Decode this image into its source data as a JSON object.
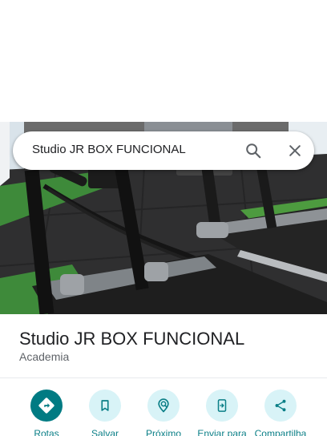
{
  "search": {
    "query": "Studio JR BOX FUNCIONAL",
    "search_icon": "search-icon",
    "clear_icon": "close-icon"
  },
  "place": {
    "photo": "gym-treadmills-photo",
    "name": "Studio JR BOX FUNCIONAL",
    "category": "Academia"
  },
  "actions": [
    {
      "label": "Rotas",
      "icon": "directions-icon"
    },
    {
      "label": "Salvar",
      "icon": "bookmark-icon"
    },
    {
      "label": "Próximo",
      "icon": "nearby-icon"
    },
    {
      "label": "Enviar para",
      "icon": "send-to-phone-icon"
    },
    {
      "label": "Compartilha",
      "icon": "share-icon"
    }
  ],
  "colors": {
    "accent": "#007b83",
    "accent_light": "#d8f3f7",
    "action_label": "#0b7f87",
    "text_primary": "#202124",
    "text_secondary": "#5f6368"
  }
}
